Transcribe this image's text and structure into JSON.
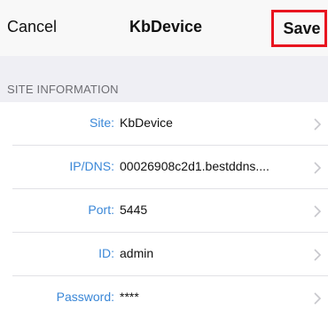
{
  "navbar": {
    "cancel_label": "Cancel",
    "title": "KbDevice",
    "save_label": "Save",
    "highlight_color": "#e8141f"
  },
  "section": {
    "header": "SITE INFORMATION"
  },
  "fields": [
    {
      "label": "Site:",
      "value": "KbDevice"
    },
    {
      "label": "IP/DNS:",
      "value": "00026908c2d1.bestddns...."
    },
    {
      "label": "Port:",
      "value": "5445"
    },
    {
      "label": "ID:",
      "value": "admin"
    },
    {
      "label": "Password:",
      "value": "****"
    }
  ],
  "colors": {
    "label": "#3a87d7",
    "group_background": "#efeff4"
  },
  "icons": {
    "disclosure": "chevron-right-icon"
  }
}
